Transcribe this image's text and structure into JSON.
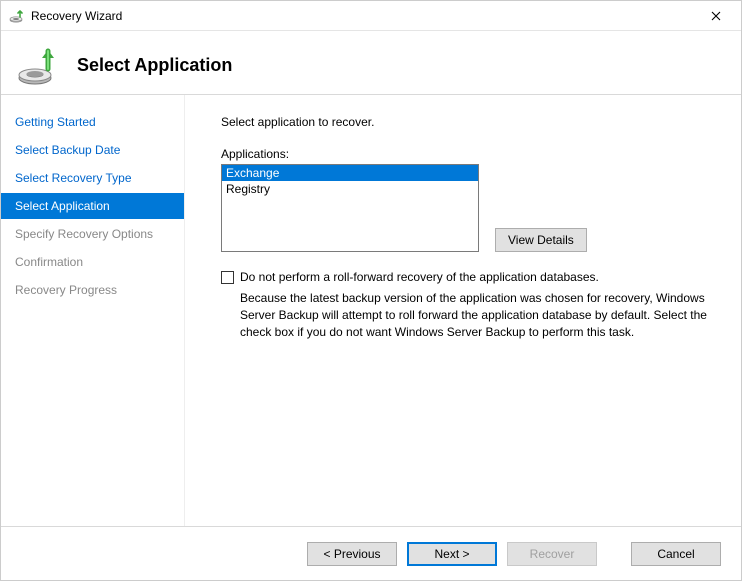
{
  "window": {
    "title": "Recovery Wizard"
  },
  "header": {
    "title": "Select Application"
  },
  "sidebar": {
    "items": [
      {
        "label": "Getting Started",
        "state": "link"
      },
      {
        "label": "Select Backup Date",
        "state": "link"
      },
      {
        "label": "Select Recovery Type",
        "state": "link"
      },
      {
        "label": "Select Application",
        "state": "current"
      },
      {
        "label": "Specify Recovery Options",
        "state": "disabled"
      },
      {
        "label": "Confirmation",
        "state": "disabled"
      },
      {
        "label": "Recovery Progress",
        "state": "disabled"
      }
    ]
  },
  "content": {
    "instruction": "Select application to recover.",
    "apps_label": "Applications:",
    "applications": [
      {
        "name": "Exchange",
        "selected": true
      },
      {
        "name": "Registry",
        "selected": false
      }
    ],
    "view_details_label": "View Details",
    "checkbox_label": "Do not perform a roll-forward recovery of the application databases.",
    "checkbox_checked": false,
    "description": "Because the latest backup version of the application was chosen for recovery, Windows Server Backup will attempt to roll forward the application database by default. Select the check box if you do not want Windows Server Backup to perform this task."
  },
  "footer": {
    "previous_label": "< Previous",
    "next_label": "Next >",
    "recover_label": "Recover",
    "cancel_label": "Cancel"
  }
}
